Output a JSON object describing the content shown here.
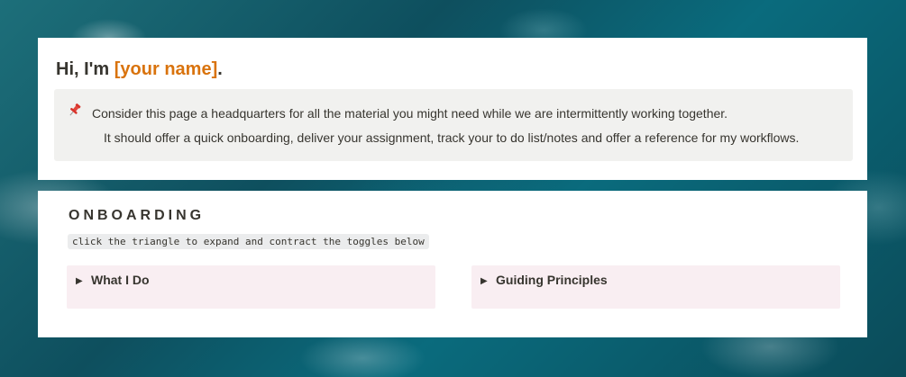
{
  "header": {
    "greeting": "Hi, I'm ",
    "name_placeholder": "[your name]",
    "period": "."
  },
  "callout": {
    "icon": "pushpin-icon",
    "line1": "Consider this page a headquarters for all the material you might need while we are intermittently working together.",
    "line2": "It should offer a quick onboarding, deliver your assignment, track your to do list/notes and offer a reference for my workflows."
  },
  "onboarding": {
    "heading": "ONBOARDING",
    "hint": "click the triangle to expand and contract the toggles below",
    "toggles": [
      {
        "label": "What I Do",
        "icon": "triangle-right-icon"
      },
      {
        "label": "Guiding Principles",
        "icon": "triangle-right-icon"
      }
    ]
  },
  "colors": {
    "name_accent": "#d9730d",
    "callout_bg": "#f1f1ef",
    "toggle_bg": "#f9eef2"
  }
}
